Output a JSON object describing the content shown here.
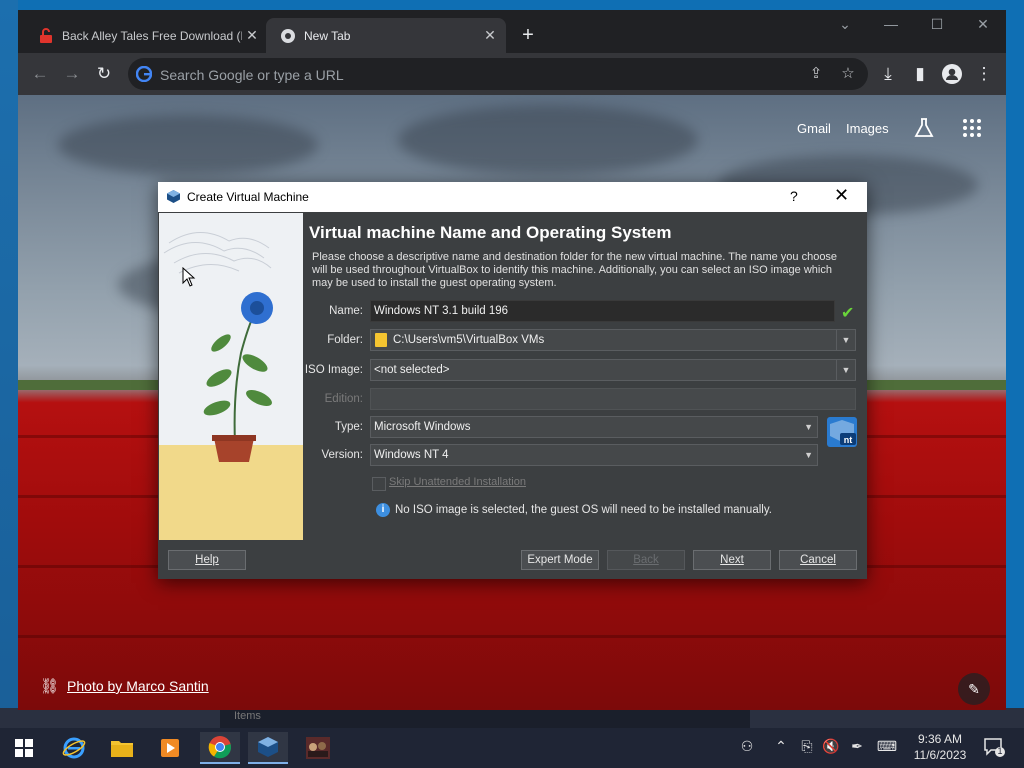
{
  "browser": {
    "tabs": [
      {
        "title": "Back Alley Tales Free Download (P",
        "active": false
      },
      {
        "title": "New Tab",
        "active": true
      }
    ],
    "omnibox_placeholder": "Search Google or type a URL"
  },
  "ntp": {
    "gmail": "Gmail",
    "images": "Images",
    "photo_credit": "Photo by Marco Santin"
  },
  "dialog": {
    "title": "Create Virtual Machine",
    "help_glyph": "?",
    "heading": "Virtual machine Name and Operating System",
    "description": "Please choose a descriptive name and destination folder for the new virtual machine. The name you choose will be used throughout VirtualBox to identify this machine. Additionally, you can select an ISO image which may be used to install the guest operating system.",
    "labels": {
      "name": "Name:",
      "folder": "Folder:",
      "iso": "ISO Image:",
      "edition": "Edition:",
      "type": "Type:",
      "version": "Version:"
    },
    "values": {
      "name": "Windows NT 3.1 build 196",
      "folder": "C:\\Users\\vm5\\VirtualBox VMs",
      "iso": "<not selected>",
      "edition": "",
      "type": "Microsoft Windows",
      "version": "Windows NT 4"
    },
    "skip_unattended": "Skip Unattended Installation",
    "info": "No ISO image is selected, the guest OS will need to be installed manually.",
    "buttons": {
      "help": "Help",
      "expert": "Expert Mode",
      "back": "Back",
      "next": "Next",
      "cancel": "Cancel"
    }
  },
  "desktop": {
    "under_text": "Items"
  },
  "taskbar": {
    "time": "9:36 AM",
    "date": "11/6/2023",
    "notification_count": "1"
  },
  "colors": {
    "chrome_dark": "#202124",
    "chrome_toolbar": "#35363a",
    "vbox_panel": "#3c3f41",
    "taskbar": "#1f2535",
    "check_green": "#6ad43a"
  }
}
